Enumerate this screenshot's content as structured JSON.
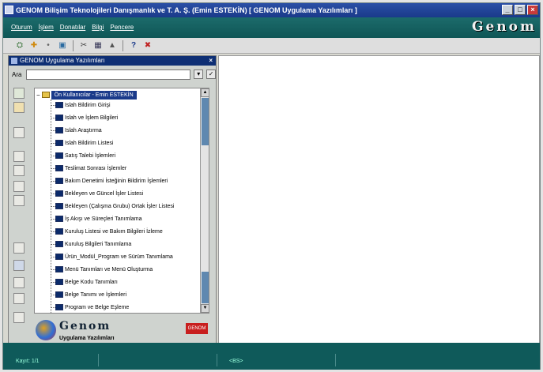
{
  "window": {
    "title": "GENOM Bilişim Teknolojileri Danışmanlık ve T. A. Ş. (Emin ESTEKİN) [ GENOM Uygulama Yazılımları ]",
    "controls": [
      "_",
      "□",
      "×"
    ]
  },
  "menubar": {
    "items": [
      "Oturum",
      "İşlem",
      "Donatılar",
      "Bilgi",
      "Pencere"
    ],
    "brand": "Genom"
  },
  "toolbar": {
    "icons": [
      "users-icon",
      "arrow-icon",
      "dot-icon",
      "stop-icon",
      "chart-icon",
      "grid-icon",
      "home-icon",
      "help-icon",
      "exit-icon"
    ],
    "glyphs": [
      "⛭",
      "✚",
      "•",
      "▣",
      "✂",
      "▦",
      "▲",
      "?",
      "✖"
    ]
  },
  "panel": {
    "title": "GENOM Uygulama Yazılımları",
    "close": "×",
    "search_label": "Ara",
    "search_value": "",
    "search_buttons": [
      "▾",
      "✓"
    ]
  },
  "tree": {
    "root": "Ön Kullanıcılar - Emin ESTEKİN",
    "items": [
      "Islah Bildirim Girişi",
      "Islah ve İşlem Bilgileri",
      "Islah Araştırma",
      "Islah Bildirim Listesi",
      "Satış Talebi İşlemleri",
      "Teslimat Sonrası İşlemler",
      "Bakım Denetimi İsteğinin Bildirim İşlemleri",
      "Bekleyen ve Güncel İşler Listesi",
      "Bekleyen (Çalışma Grubu) Ortak İşler Listesi",
      "İş Akışı ve Süreçleri Tanımlama",
      "Kuruluş Listesi ve Bakım Bilgileri İzleme",
      "Kuruluş Bilgileri Tanımlama",
      "Ürün_Modül_Program ve Sürüm Tanımlama",
      "Menü Tanımları ve Menü Oluşturma",
      "Belge Kodu Tanımları",
      "Belge Tanımı ve İşlemleri",
      "Program ve Belge Eşleme"
    ]
  },
  "logo": {
    "name": "Genom",
    "tagline": "Uygulama Yazılımları",
    "badge": "GENOM"
  },
  "status": {
    "left": "Kayıt: 1/1",
    "middle": "<BS>"
  },
  "colors": {
    "menubar": "#0f5656",
    "titlebar": "#1a3a8a",
    "selection": "#1a3a8a",
    "statusbar": "#0f5a5a"
  }
}
